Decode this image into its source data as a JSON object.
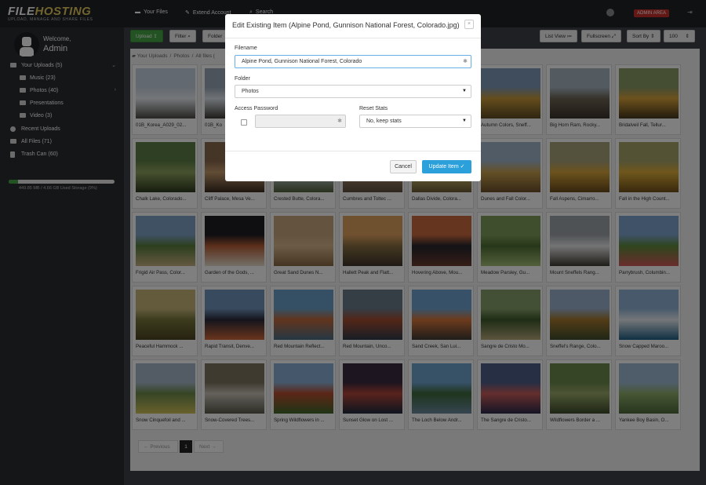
{
  "topbar": {
    "logo_main": "FILE",
    "logo_accent": "HOSTING",
    "logo_tagline": "UPLOAD, MANAGE AND SHARE FILES",
    "nav_files": "Your Files",
    "nav_extend": "Extend Account",
    "nav_search": "Search",
    "admin_area": "ADMIN AREA"
  },
  "sidebar": {
    "welcome": "Welcome,",
    "user": "Admin",
    "items": [
      {
        "label": "Your Uploads (5)"
      },
      {
        "label": "Music (23)"
      },
      {
        "label": "Photos (40)"
      },
      {
        "label": "Presentations"
      },
      {
        "label": "Video (3)"
      },
      {
        "label": "Recent Uploads"
      },
      {
        "label": "All Files (71)"
      },
      {
        "label": "Trash Can (60)"
      }
    ],
    "storage_text": "449.85 MB / 4.66 GB Used Storage (9%)",
    "storage_fraction": 0.09
  },
  "toolbar": {
    "upload": "Upload",
    "filter": "Filter",
    "folder": "Folder",
    "list_view": "List View",
    "fullscreen": "Fullscreen",
    "sort_by": "Sort By",
    "per_page": "100"
  },
  "breadcrumb": {
    "root": "Your Uploads",
    "folder": "Photos",
    "count": "All files ("
  },
  "files": [
    "01B_Korea_A029_02...",
    "01B_Ko",
    "",
    "",
    "",
    "Autumn Colors, Sneff...",
    "Big Horn Ram, Rocky...",
    "Bridalveil Fall, Tellur...",
    "Chalk Lake, Colorado...",
    "Cliff Palace, Mesa Ve...",
    "Crested Butte, Colora...",
    "Cumbres and Toltec ...",
    "Dallas Divide, Colora...",
    "Dunes and Fall Color...",
    "Fall Aspens, Cimarro...",
    "Fall in the High Count...",
    "Frigid Air Pass, Color...",
    "Garden of the Gods, ...",
    "Great Sand Dunes N...",
    "Hallett Peak and Flatt...",
    "Hovering Above, Mou...",
    "Meadow Parsley, Gu...",
    "Mount Sneffels Rang...",
    "Parrybrush, Columbin...",
    "Peaceful Hammock ...",
    "Rapid Transit, Denve...",
    "Red Mountain Reflect...",
    "Red Mountain, Unco...",
    "Sand Creek, San Lui...",
    "Sangre de Cristo Mo...",
    "Sneffel's Range, Colo...",
    "Snow Capped Maroo...",
    "Snow Cinquefoil and ...",
    "Snow-Covered Trees...",
    "Spring Wildflowers in ...",
    "Sunset Glow on Lost ...",
    "The Loch Below Andr...",
    "The Sangre de Cristo...",
    "Wildflowers Border a ...",
    "Yankee Boy Basin, O..."
  ],
  "pagination": {
    "prev": "Previous",
    "current": "1",
    "next": "Next"
  },
  "modal": {
    "title": "Edit Existing Item (Alpine Pond, Gunnison National Forest, Colorado.jpg)",
    "filename_label": "Filename",
    "filename_value": "Alpine Pond, Gunnison National Forest, Colorado",
    "folder_label": "Folder",
    "folder_value": "Photos",
    "password_label": "Access Password",
    "reset_label": "Reset Stats",
    "reset_value": "No, keep stats",
    "cancel": "Cancel",
    "update": "Update Item"
  }
}
